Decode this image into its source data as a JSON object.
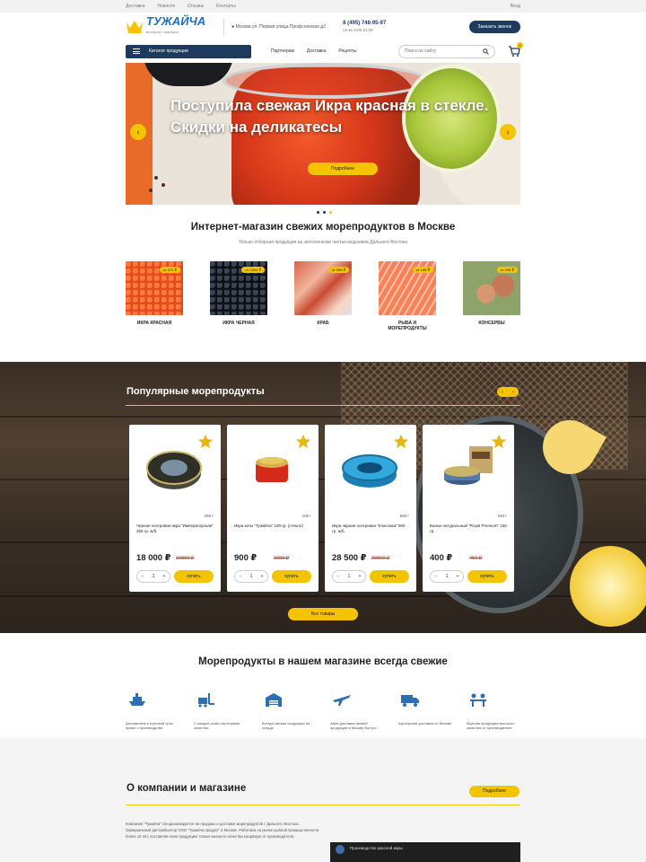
{
  "topbar": {
    "links": [
      "Доставка",
      "Новости",
      "Отзывы",
      "Контакты"
    ],
    "login": "Вход"
  },
  "header": {
    "logo_name": "ТУЖАЙЧА",
    "logo_tagline": "интернет-магазин",
    "address": "Москва ул. Первая улица Профсоюзная д2",
    "phone": "8 (495) 748-95-97",
    "phone_note": "пн-вс 9:00-21:00",
    "call_button": "Заказать звонок"
  },
  "nav": {
    "catalog_button": "Каталог продукции",
    "links": [
      "Партнерам",
      "Доставка",
      "Рецепты"
    ],
    "search_placeholder": "Поиск по сайту",
    "cart_count": "0"
  },
  "hero": {
    "title": "Поступила свежая Икра красная в стекле. Скидки на деликатесы",
    "button": "Подробнее"
  },
  "shop_section": {
    "title": "Интернет-магазин свежих морепродуктов в Москве",
    "subtitle": "Только отборная продукция из экологически чистых водоемов Дальнего Востока",
    "categories": [
      {
        "label": "ИКРА КРАСНАЯ",
        "price": "от 470 ₽"
      },
      {
        "label": "ИКРА ЧЕРНАЯ",
        "price": "от 2500 ₽"
      },
      {
        "label": "КРАБ",
        "price": "от 950 ₽"
      },
      {
        "label": "РЫБА И МОРЕПРОДУКТЫ",
        "price": "от 185 ₽"
      },
      {
        "label": "КОНСЕРВЫ",
        "price": "от 295 ₽"
      }
    ]
  },
  "popular": {
    "title": "Популярные морепродукты",
    "products": [
      {
        "weight": "250 г",
        "name": "Черная осетровая икра \"Императорская\" 250 гр. ж/б.",
        "price": "18 000 ₽",
        "old_price": "19800 ₽",
        "qty": "1",
        "buy": "купить"
      },
      {
        "weight": "100 г",
        "name": "Икра кеты \"Тужайча\" 100 гр. (стекло)",
        "price": "900 ₽",
        "old_price": "1000 ₽",
        "qty": "1",
        "buy": "купить"
      },
      {
        "weight": "500 г",
        "name": "Икра черная осетровая \"Классика\" 500 гр. ж/б.",
        "price": "28 500 ₽",
        "old_price": "29900 ₽",
        "qty": "1",
        "buy": "купить"
      },
      {
        "weight": "240 г",
        "name": "Балык натуральный \"Royal Premium\" 240 гр.",
        "price": "400 ₽",
        "old_price": "450 ₽",
        "qty": "1",
        "buy": "купить"
      }
    ],
    "all_button": "Все товары"
  },
  "fresh_section": {
    "title": "Морепродукты в нашем магазине всегда свежие",
    "features": [
      {
        "icon": "ship-icon",
        "text": "Доставляем в короткий срок прямо с производства"
      },
      {
        "icon": "forklift-icon",
        "text": "С каждой рыбы сертификат качества"
      },
      {
        "icon": "warehouse-icon",
        "text": "Всегда свежая продукция на складе"
      },
      {
        "icon": "plane-icon",
        "text": "Авиа доставка свежей продукции в Москву быстро"
      },
      {
        "icon": "truck-icon",
        "text": "Курьерская доставка по Москве"
      },
      {
        "icon": "team-icon",
        "text": "Вкусная продукция высокого качества от производителя"
      }
    ]
  },
  "about": {
    "title": "О компании и магазине",
    "button": "Подробнее",
    "text": "Компания \"Тужайча\" специализируется на продаже и доставке морепродуктов с Дальнего Востока. Официальный дистрибьютор ООО \"Тужайча продукт\" в Москве. Работаем на рынке рыбной промышленности более 15 лет, поставляя свою продукцию только высшего качества напрямую от производителя.",
    "video_title": "Производство красной икры"
  },
  "colors": {
    "accent": "#f5c400",
    "brand": "#1d3b5c",
    "sale": "#e0301e"
  }
}
